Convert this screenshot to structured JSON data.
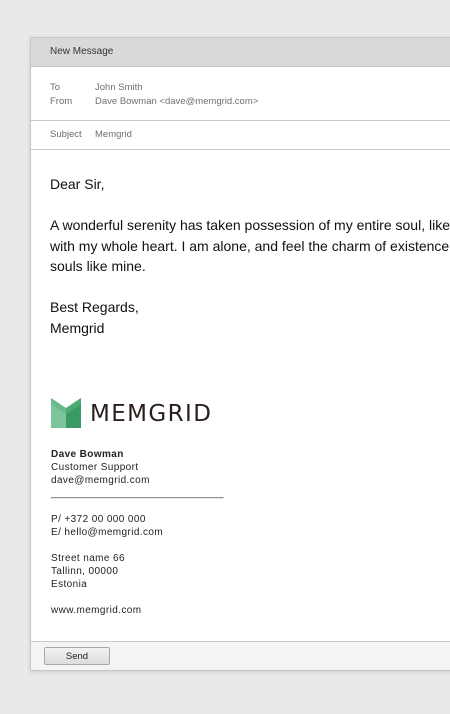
{
  "window": {
    "title": "New Message"
  },
  "header": {
    "to_label": "To",
    "to_value": "John Smith",
    "from_label": "From",
    "from_value": "Dave Bowman <dave@memgrid.com>",
    "subject_label": "Subject",
    "subject_value": "Memgrid"
  },
  "body": {
    "greeting": "Dear Sir,",
    "paragraph_lines": [
      "A wonderful serenity has taken possession of my entire soul, like",
      "with my whole heart. I am alone, and feel the charm of existence",
      "souls like mine."
    ],
    "closing": "Best Regards,",
    "sender": "Memgrid"
  },
  "signature": {
    "logo_text": "MEMGRID",
    "logo_icon": "memgrid-logo-icon",
    "name": "Dave Bowman",
    "role": "Customer Support",
    "email": "dave@memgrid.com",
    "separator": "_______________________________",
    "phone": "P/ +372 00 000 000",
    "contact_email": "E/ hello@memgrid.com",
    "street": "Street name 66",
    "city": "Tallinn, 00000",
    "country": "Estonia",
    "website": "www.memgrid.com"
  },
  "footer": {
    "send_label": "Send"
  },
  "colors": {
    "logo_green_light": "#7cc49a",
    "logo_green_dark": "#3a9a63",
    "logo_text": "#2b1f1e"
  }
}
